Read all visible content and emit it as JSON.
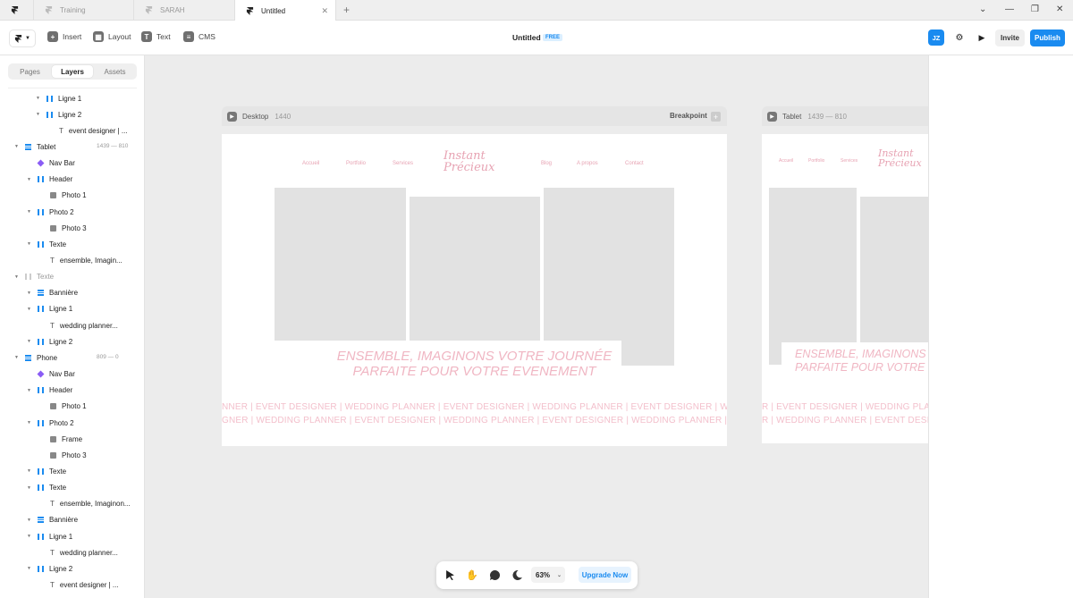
{
  "tabs": [
    {
      "label": "Training"
    },
    {
      "label": "SARAH"
    },
    {
      "label": "Untitled"
    }
  ],
  "toolbar": {
    "insert": "Insert",
    "layout": "Layout",
    "text": "Text",
    "cms": "CMS",
    "title": "Untitled",
    "badge": "FREE",
    "avatar": "JZ",
    "invite": "Invite",
    "publish": "Publish"
  },
  "sidebar": {
    "tabs": [
      "Pages",
      "Layers",
      "Assets"
    ],
    "layers": [
      {
        "label": "Ligne 1",
        "icon": "columns-icon",
        "caret": true
      },
      {
        "label": "Ligne 2",
        "icon": "columns-icon",
        "caret": true
      },
      {
        "label": "event designer | ...",
        "icon": "text-icon",
        "caret": false
      },
      {
        "label": "Tablet",
        "icon": "stack-icon",
        "caret": true,
        "dims": "1439 — 810"
      },
      {
        "label": "Nav Bar",
        "icon": "component-icon",
        "caret": false
      },
      {
        "label": "Header",
        "icon": "columns-icon",
        "caret": true
      },
      {
        "label": "Photo 1",
        "icon": "image-icon",
        "caret": false
      },
      {
        "label": "Photo 2",
        "icon": "columns-icon",
        "caret": true
      },
      {
        "label": "Photo 3",
        "icon": "image-icon",
        "caret": false
      },
      {
        "label": "Texte",
        "icon": "columns-icon",
        "caret": true
      },
      {
        "label": "ensemble, Imagin...",
        "icon": "text-icon",
        "caret": false
      },
      {
        "label": "Texte",
        "icon": "columns-icon",
        "caret": true
      },
      {
        "label": "Bannière",
        "icon": "stack-icon",
        "caret": true
      },
      {
        "label": "Ligne 1",
        "icon": "columns-icon",
        "caret": true
      },
      {
        "label": "wedding planner...",
        "icon": "text-icon",
        "caret": false
      },
      {
        "label": "Ligne 2",
        "icon": "columns-icon",
        "caret": true
      },
      {
        "label": "Phone",
        "icon": "stack-icon",
        "caret": true,
        "dims": "809 — 0"
      },
      {
        "label": "Nav Bar",
        "icon": "component-icon",
        "caret": false
      },
      {
        "label": "Header",
        "icon": "columns-icon",
        "caret": true
      },
      {
        "label": "Photo 1",
        "icon": "image-icon",
        "caret": false
      },
      {
        "label": "Photo 2",
        "icon": "columns-icon",
        "caret": true
      },
      {
        "label": "Frame",
        "icon": "image-icon",
        "caret": false
      },
      {
        "label": "Photo 3",
        "icon": "image-icon",
        "caret": false
      },
      {
        "label": "Texte",
        "icon": "columns-icon",
        "caret": true
      },
      {
        "label": "Texte",
        "icon": "columns-icon",
        "caret": true
      },
      {
        "label": "ensemble, Imaginon...",
        "icon": "text-icon",
        "caret": false
      },
      {
        "label": "Bannière",
        "icon": "stack-icon",
        "caret": true
      },
      {
        "label": "Ligne 1",
        "icon": "columns-icon",
        "caret": true
      },
      {
        "label": "wedding planner...",
        "icon": "text-icon",
        "caret": false
      },
      {
        "label": "Ligne 2",
        "icon": "columns-icon",
        "caret": true
      },
      {
        "label": "event designer | ...",
        "icon": "text-icon",
        "caret": false
      }
    ]
  },
  "canvas": {
    "desktop": {
      "label": "Desktop",
      "width": "1440",
      "breakpoint": "Breakpoint"
    },
    "tablet": {
      "label": "Tablet",
      "width": "1439 — 810"
    },
    "nav": [
      "Accueil",
      "Portfolio",
      "Services",
      "Blog",
      "A propos",
      "Contact"
    ],
    "logo": "Instant Précieux",
    "hero_line1": "ENSEMBLE, IMAGINONS VOTRE JOURNÉE",
    "hero_line2": "PARFAITE POUR VOTRE EVENEMENT",
    "ticker1": "NNER | EVENT DESIGNER | WEDDING PLANNER | EVENT DESIGNER | WEDDING PLANNER | EVENT DESIGNER | WEDDING PLANNER",
    "ticker2": "GNER | WEDDING PLANNER | EVENT DESIGNER | WEDDING PLANNER | EVENT DESIGNER | WEDDING PLANNER | EVENT DESIGNER",
    "tablet_nav": [
      "Accueil",
      "Portfolio",
      "Services"
    ],
    "tablet_hero_line1": "ENSEMBLE, IMAGINONS V",
    "tablet_hero_line2": "PARFAITE POUR VOTRE",
    "tablet_ticker1": "R | EVENT DESIGNER | WEDDING PLANNER | EVENT",
    "tablet_ticker2": "R | WEDDING PLANNER | EVENT DESIGNER | WEDDING PLAN"
  },
  "bottombar": {
    "zoom": "63%",
    "upgrade": "Upgrade Now"
  }
}
